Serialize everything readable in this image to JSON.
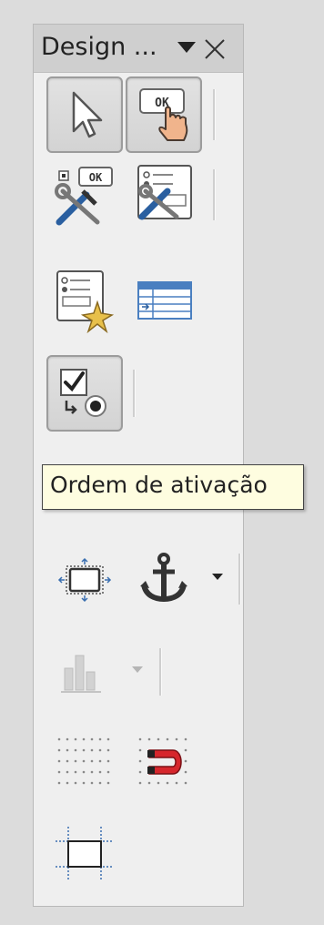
{
  "panel": {
    "title": "Design ...",
    "menu_arrow_icon": "triangle-down-icon",
    "close_icon": "close-icon"
  },
  "toolbar": {
    "buttons": [
      {
        "name": "select-button",
        "icon": "pointer-arrow-icon",
        "pressed": true
      },
      {
        "name": "design-mode-button",
        "icon": "ok-hand-pointer-icon",
        "pressed": true
      },
      {
        "name": "control-properties-button",
        "icon": "tools-ok-icon"
      },
      {
        "name": "form-properties-button",
        "icon": "tools-form-icon"
      },
      {
        "name": "form-navigator-button",
        "icon": "form-star-icon"
      },
      {
        "name": "add-field-button",
        "icon": "table-icon"
      },
      {
        "name": "activation-order-button",
        "icon": "checkbox-radio-icon",
        "pressed": true
      },
      {
        "name": "position-size-button",
        "icon": "resize-frame-icon"
      },
      {
        "name": "anchor-button",
        "icon": "anchor-icon"
      },
      {
        "name": "alignment-button",
        "icon": "bar-chart-icon",
        "disabled": true
      },
      {
        "name": "grid-button",
        "icon": "dot-grid-icon"
      },
      {
        "name": "snap-to-grid-button",
        "icon": "magnet-icon"
      },
      {
        "name": "guides-button",
        "icon": "guide-lines-icon"
      }
    ]
  },
  "tooltip": {
    "text": "Ordem de ativação"
  },
  "colors": {
    "panel_bg": "#efefef",
    "titlebar_bg": "#cfcfcf",
    "tooltip_bg": "#fefde0",
    "magnet_red": "#d6262c",
    "guide_blue": "#3a6fb0"
  }
}
